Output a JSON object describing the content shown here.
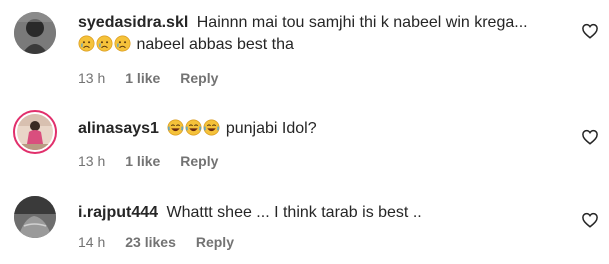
{
  "comments": [
    {
      "username": "syedasidra.skl",
      "text_line1": "Hainnn mai tou samjhi thi k nabeel win krega...",
      "emojis": [
        "sad-crying-face-emoji",
        "sad-crying-face-emoji",
        "sad-crying-face-emoji"
      ],
      "text_line2": "nabeel abbas best tha",
      "time": "13 h",
      "likes": "1 like",
      "reply": "Reply"
    },
    {
      "username": "alinasays1",
      "emojis": [
        "laughing-tears-emoji",
        "laughing-tears-emoji",
        "laughing-tears-emoji"
      ],
      "text": "punjabi Idol?",
      "time": "13 h",
      "likes": "1 like",
      "reply": "Reply"
    },
    {
      "username": "i.rajput444",
      "text": "Whattt shee ... I think tarab is best ..",
      "time": "14 h",
      "likes": "23 likes",
      "reply": "Reply"
    }
  ],
  "colors": {
    "text": "#262626",
    "meta": "#737373",
    "story_ring": "#e1306c"
  },
  "icons": {
    "like": "heart-outline-icon"
  }
}
